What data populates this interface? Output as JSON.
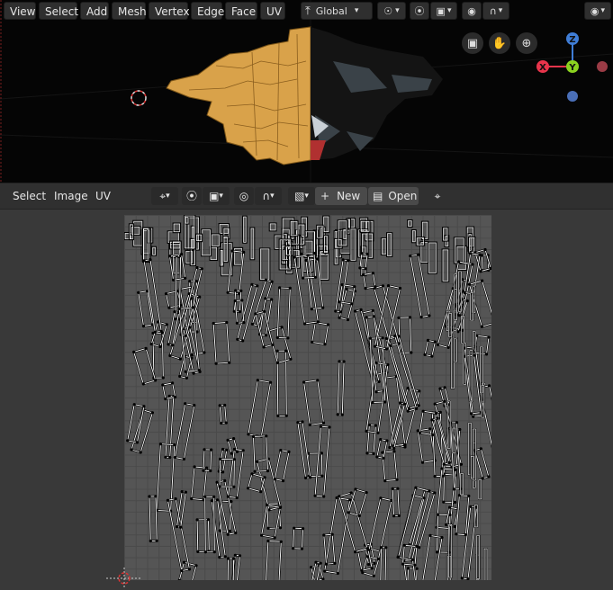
{
  "viewport_header": {
    "menus": [
      "View",
      "Select",
      "Add",
      "Mesh",
      "Vertex",
      "Edge",
      "Face",
      "UV"
    ],
    "transform_orientation": "Global"
  },
  "gizmo": {
    "axes": {
      "x": "X",
      "y": "Y",
      "z": "Z"
    },
    "colors": {
      "x": "#e8344b",
      "y": "#8bd21f",
      "z": "#3f7dd6",
      "neg_x": "#9a3b45",
      "neg_y": "#4a6fb8"
    }
  },
  "uv_header": {
    "menus": [
      "Select",
      "Image",
      "UV"
    ],
    "new_label": "New",
    "open_label": "Open"
  },
  "icons": [
    "camera-icon",
    "hand-icon",
    "zoom-icon",
    "cursor-icon",
    "snap-icon",
    "pivot-icon",
    "proportional-icon",
    "falloff-icon",
    "eye-icon",
    "image-icon",
    "plus-icon",
    "folder-icon",
    "pin-icon"
  ],
  "colors": {
    "mesh_gold": "#d9a24a",
    "viewport_bg": "#050505",
    "uv_grid": "#555555"
  }
}
